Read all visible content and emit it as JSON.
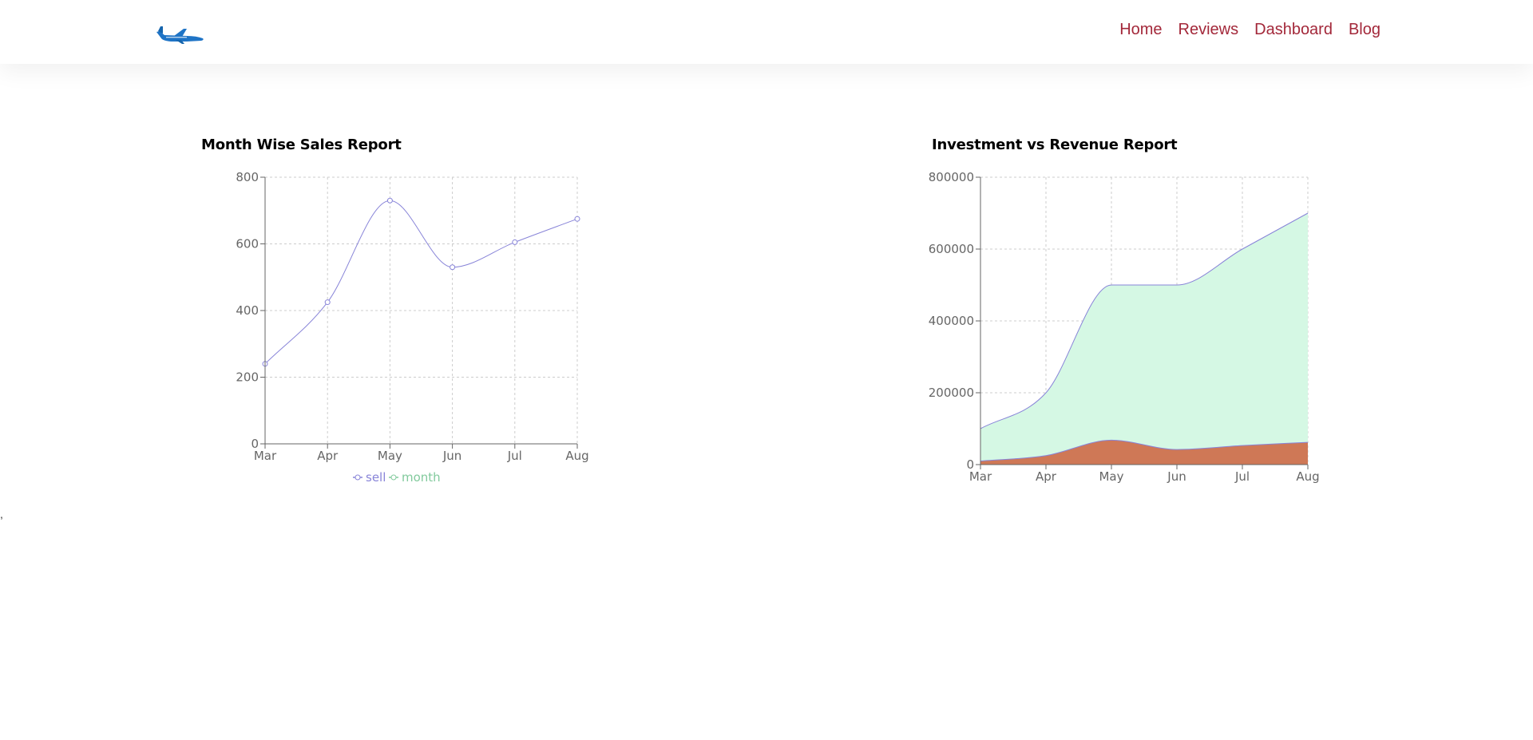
{
  "colors": {
    "nav_link": "#a3283a",
    "logo_blue": "#1f74c6",
    "sell_line": "#8884d8",
    "month_legend": "#82ca9d",
    "investment_fill": "#d5f8e4",
    "revenue_fill": "#cf7856",
    "grid": "#cccccc",
    "axis": "#666666",
    "tick_text": "#666666"
  },
  "header": {
    "logo_icon": "airplane-icon",
    "nav": [
      {
        "label": "Home"
      },
      {
        "label": "Reviews"
      },
      {
        "label": "Dashboard"
      },
      {
        "label": "Blog"
      }
    ]
  },
  "stray_mark": ",",
  "charts": {
    "sales": {
      "title": "Month Wise Sales Report"
    },
    "investment": {
      "title": "Investment vs Revenue Report"
    }
  },
  "chart_data": [
    {
      "type": "line",
      "title": "Month Wise Sales Report",
      "categories": [
        "Mar",
        "Apr",
        "May",
        "Jun",
        "Jul",
        "Aug"
      ],
      "series": [
        {
          "name": "sell",
          "values": [
            240,
            425,
            730,
            530,
            605,
            675
          ]
        }
      ],
      "legend": [
        "sell",
        "month"
      ],
      "legend_position": "bottom",
      "yticks": [
        0,
        200,
        400,
        600,
        800
      ],
      "ylim": [
        0,
        800
      ],
      "grid": true
    },
    {
      "type": "area",
      "title": "Investment vs Revenue Report",
      "categories": [
        "Mar",
        "Apr",
        "May",
        "Jun",
        "Jul",
        "Aug"
      ],
      "series": [
        {
          "values": [
            100000,
            200000,
            500000,
            500000,
            600000,
            700000
          ]
        },
        {
          "values": [
            10000,
            25000,
            68000,
            42000,
            53000,
            62000
          ]
        }
      ],
      "yticks": [
        0,
        200000,
        400000,
        600000,
        800000
      ],
      "ylim": [
        0,
        800000
      ],
      "grid": true
    }
  ]
}
